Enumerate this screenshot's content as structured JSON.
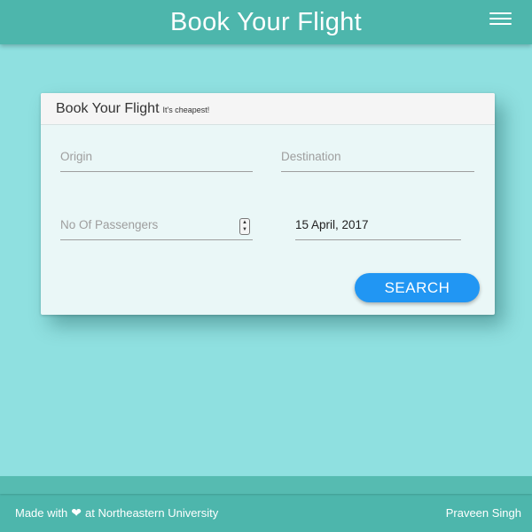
{
  "header": {
    "title": "Book Your Flight",
    "menu_icon": "hamburger-menu-icon"
  },
  "card": {
    "title": "Book Your Flight",
    "subtitle": "It's cheapest!",
    "fields": {
      "origin": {
        "placeholder": "Origin",
        "value": ""
      },
      "destination": {
        "placeholder": "Destination",
        "value": ""
      },
      "passengers": {
        "placeholder": "No Of Passengers",
        "value": ""
      },
      "date": {
        "value": "15 April, 2017"
      }
    },
    "search_label": "SEARCH"
  },
  "footer": {
    "made_with_prefix": "Made with",
    "heart_icon": "heart-icon",
    "made_with_suffix": "at Northeastern University",
    "author": "Praveen Singh"
  },
  "colors": {
    "page_background": "#8fe0e0",
    "header_background": "#4db6ac",
    "card_background": "#eaf7f7",
    "button_background": "#2196f3"
  }
}
